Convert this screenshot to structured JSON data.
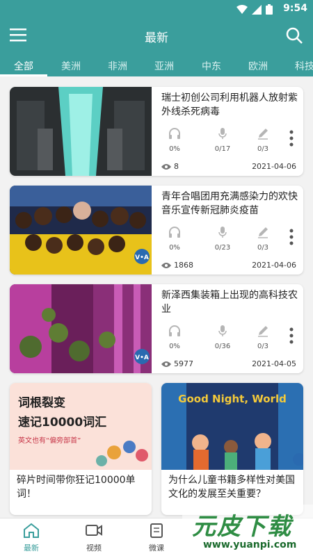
{
  "status_bar": {
    "time": "9:54"
  },
  "header": {
    "title": "最新"
  },
  "tabs": [
    "全部",
    "美洲",
    "非洲",
    "亚洲",
    "中东",
    "欧洲",
    "科技"
  ],
  "articles": [
    {
      "title": "瑞士初创公司利用机器人放射紫外线杀死病毒",
      "listen": "0%",
      "voice": "0/17",
      "write": "0/3",
      "views": "8",
      "date": "2021-04-06"
    },
    {
      "title": "青年合唱团用充满感染力的欢快音乐宣传新冠肺炎疫苗",
      "listen": "0%",
      "voice": "0/23",
      "write": "0/3",
      "views": "1868",
      "date": "2021-04-06"
    },
    {
      "title": "新泽西集装箱上出现的高科技农业",
      "listen": "0%",
      "voice": "0/36",
      "write": "0/3",
      "views": "5977",
      "date": "2021-04-05"
    }
  ],
  "grid": [
    {
      "title": "碎片时间带你狂记10000单词！",
      "banner_line1": "词根裂变",
      "banner_line2": "速记10000词汇",
      "banner_line3": "英文也有“偏旁部首”"
    },
    {
      "title": "为什么儿童书籍多样性对美国文化的发展至关重要？",
      "book_title": "Good Night, World"
    }
  ],
  "bottom_nav": [
    "最新",
    "视频",
    "微课"
  ],
  "badges": {
    "voa": "V•A"
  },
  "watermark": {
    "main": "元皮下载",
    "url": "www.yuanpi.com"
  },
  "colors": {
    "primary": "#3a9e9c",
    "text": "#222222",
    "icon_grey": "#b5b5b5"
  }
}
